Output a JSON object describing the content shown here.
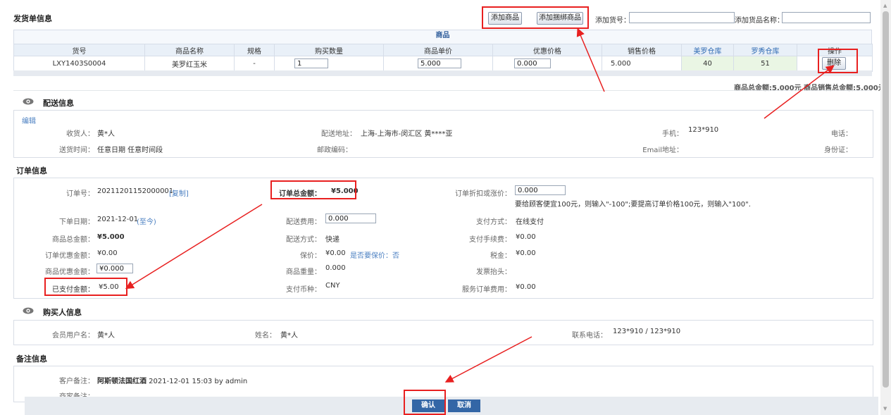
{
  "shipping": {
    "title": "发货单信息",
    "add_goods_btn": "添加商品",
    "add_bundle_btn": "添加捆绑商品",
    "add_sku_label": "添加货号：",
    "add_name_label": "添加货品名称：",
    "goods_caption": "商品",
    "headers": [
      "货号",
      "商品名称",
      "规格",
      "购买数量",
      "商品单价",
      "优惠价格",
      "销售价格",
      "美罗仓库",
      "罗秀仓库",
      "操作"
    ],
    "row": {
      "sku": "LXY1403S0004",
      "name": "美罗红玉米",
      "spec": "-",
      "qty": "1",
      "unit_price": "5.000",
      "discount": "0.000",
      "sale_price": "5.000",
      "stock1": "40",
      "stock2": "51",
      "delete_btn": "删除"
    },
    "totals": "商品总金额:5.000元  商品销售总金额:5.000元"
  },
  "delivery": {
    "title": "配送信息",
    "edit_link": "编辑",
    "receiver_label": "收货人：",
    "receiver": "黄*人",
    "address_label": "配送地址：",
    "address": "上海-上海市-闵汇区 黄****亚",
    "mobile_label": "手机：",
    "mobile": "123*910",
    "phone_label": "电话：",
    "time_label": "送货时间：",
    "time": "任意日期 任意时间段",
    "zip_label": "邮政编码：",
    "email_label": "Email地址：",
    "id_label": "身份证："
  },
  "order": {
    "title": "订单信息",
    "no_label": "订单号：",
    "no": "20211201152000001",
    "copy": "[复制]",
    "total_label": "订单总金额：",
    "total": "¥5.000",
    "adjust_label": "订单折扣或涨价：",
    "adjust": "0.000",
    "adjust_hint": "要给顾客便宜100元，则输入\"-100\";要提高订单价格100元，则输入\"100\".",
    "date_label": "下单日期：",
    "date": "2021-12-01",
    "date_suffix": "(至今)",
    "ship_fee_label": "配送费用：",
    "ship_fee": "0.000",
    "pay_method_label": "支付方式：",
    "pay_method": "在线支付",
    "goods_total_label": "商品总金额：",
    "goods_total": "¥5.000",
    "ship_way_label": "配送方式：",
    "ship_way": "快递",
    "pay_fee_label": "支付手续费：",
    "pay_fee": "¥0.00",
    "order_discount_label": "订单优惠金额：",
    "order_discount": "¥0.00",
    "insure_label": "保价：",
    "insure": "¥0.00",
    "insure_q": "是否要保价：否",
    "tax_label": "税金：",
    "tax": "¥0.00",
    "goods_discount_label": "商品优惠金额：",
    "goods_discount": "¥0.000",
    "weight_label": "商品重量：",
    "weight": "0.000",
    "invoice_label": "发票抬头：",
    "paid_label": "已支付金额：",
    "paid": "¥5.00",
    "currency_label": "支付币种：",
    "currency": "CNY",
    "service_fee_label": "服务订单费用：",
    "service_fee": "¥0.00"
  },
  "buyer": {
    "title": "购买人信息",
    "user_label": "会员用户名：",
    "user": "黄*人",
    "name_label": "姓名：",
    "name": "黄*人",
    "phone_label": "联系电话：",
    "phone": "123*910 / 123*910"
  },
  "remarks": {
    "title": "备注信息",
    "customer_label": "客户备注：",
    "customer_bold": "阿斯顿法国红酒",
    "customer_rest": " 2021-12-01 15:03 by admin",
    "merchant_label": "商家备注："
  },
  "footer": {
    "confirm": "确认",
    "cancel": "取消"
  },
  "colors": {
    "accent": "#2e5c9a",
    "highlight": "#e82020",
    "table_head": "#e9f0f8",
    "stock_bg": "#eaf6e4"
  }
}
